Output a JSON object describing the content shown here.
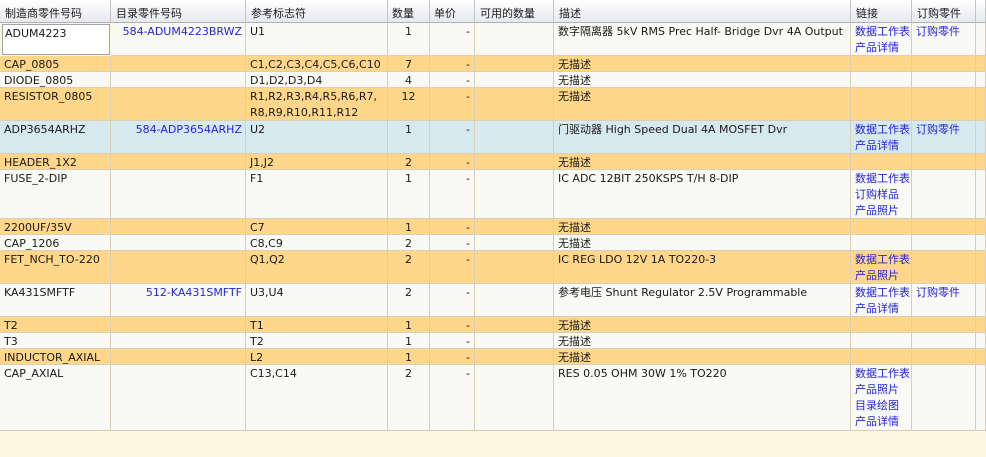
{
  "headers": [
    "制造商零件号码",
    "目录零件号码",
    "参考标志符",
    "数量",
    "单价",
    "可用的数量",
    "描述",
    "链接",
    "订购零件"
  ],
  "rows": [
    {
      "mfr": "ADUM4223",
      "cat": "584-ADUM4223BRWZ",
      "ref": "U1",
      "qty": "1",
      "price": "-",
      "avail": "",
      "desc": "数字隔离器 5kV RMS Prec Half- Bridge Dvr 4A Output",
      "links": [
        "数据工作表",
        "产品详情"
      ],
      "order": "订购零件",
      "bg": "white",
      "selected": true
    },
    {
      "mfr": "CAP_0805",
      "cat": "",
      "ref": "C1,C2,C3,C4,C5,C6,C10",
      "qty": "7",
      "price": "-",
      "avail": "",
      "desc": "无描述",
      "links": [],
      "order": "",
      "bg": "yellow"
    },
    {
      "mfr": "DIODE_0805",
      "cat": "",
      "ref": "D1,D2,D3,D4",
      "qty": "4",
      "price": "-",
      "avail": "",
      "desc": "无描述",
      "links": [],
      "order": "",
      "bg": "white"
    },
    {
      "mfr": "RESISTOR_0805",
      "cat": "",
      "ref": "R1,R2,R3,R4,R5,R6,R7, R8,R9,R10,R11,R12",
      "qty": "12",
      "price": "-",
      "avail": "",
      "desc": "无描述",
      "links": [],
      "order": "",
      "bg": "yellow"
    },
    {
      "mfr": "ADP3654ARHZ",
      "cat": "584-ADP3654ARHZ",
      "ref": "U2",
      "qty": "1",
      "price": "-",
      "avail": "",
      "desc": "门驱动器 High Speed Dual 4A MOSFET Dvr",
      "links": [
        "数据工作表",
        "产品详情"
      ],
      "order": "订购零件",
      "bg": "blue"
    },
    {
      "mfr": "HEADER_1X2",
      "cat": "",
      "ref": "J1,J2",
      "qty": "2",
      "price": "-",
      "avail": "",
      "desc": "无描述",
      "links": [],
      "order": "",
      "bg": "yellow"
    },
    {
      "mfr": "FUSE_2-DIP",
      "cat": "",
      "ref": "F1",
      "qty": "1",
      "price": "-",
      "avail": "",
      "desc": "IC ADC 12BIT 250KSPS T/H 8-DIP",
      "links": [
        "数据工作表",
        "订购样品",
        "产品照片"
      ],
      "order": "",
      "bg": "white"
    },
    {
      "mfr": "2200UF/35V",
      "cat": "",
      "ref": "C7",
      "qty": "1",
      "price": "-",
      "avail": "",
      "desc": "无描述",
      "links": [],
      "order": "",
      "bg": "yellow"
    },
    {
      "mfr": "CAP_1206",
      "cat": "",
      "ref": "C8,C9",
      "qty": "2",
      "price": "-",
      "avail": "",
      "desc": "无描述",
      "links": [],
      "order": "",
      "bg": "white"
    },
    {
      "mfr": "FET_NCH_TO-220",
      "cat": "",
      "ref": "Q1,Q2",
      "qty": "2",
      "price": "-",
      "avail": "",
      "desc": "IC REG LDO 12V 1A TO220-3",
      "links": [
        "数据工作表",
        "产品照片"
      ],
      "order": "",
      "bg": "yellow"
    },
    {
      "mfr": "KA431SMFTF",
      "cat": "512-KA431SMFTF",
      "ref": "U3,U4",
      "qty": "2",
      "price": "-",
      "avail": "",
      "desc": "参考电压 Shunt Regulator 2.5V Programmable",
      "links": [
        "数据工作表",
        "产品详情"
      ],
      "order": "订购零件",
      "bg": "white"
    },
    {
      "mfr": "T2",
      "cat": "",
      "ref": "T1",
      "qty": "1",
      "price": "-",
      "avail": "",
      "desc": "无描述",
      "links": [],
      "order": "",
      "bg": "yellow"
    },
    {
      "mfr": "T3",
      "cat": "",
      "ref": "T2",
      "qty": "1",
      "price": "-",
      "avail": "",
      "desc": "无描述",
      "links": [],
      "order": "",
      "bg": "white"
    },
    {
      "mfr": "INDUCTOR_AXIAL",
      "cat": "",
      "ref": "L2",
      "qty": "1",
      "price": "-",
      "avail": "",
      "desc": "无描述",
      "links": [],
      "order": "",
      "bg": "yellow"
    },
    {
      "mfr": "CAP_AXIAL",
      "cat": "",
      "ref": "C13,C14",
      "qty": "2",
      "price": "-",
      "avail": "",
      "desc": "RES 0.05 OHM 30W 1% TO220",
      "links": [
        "数据工作表",
        "产品照片",
        "目录绘图",
        "产品详情"
      ],
      "order": "",
      "bg": "white"
    }
  ]
}
